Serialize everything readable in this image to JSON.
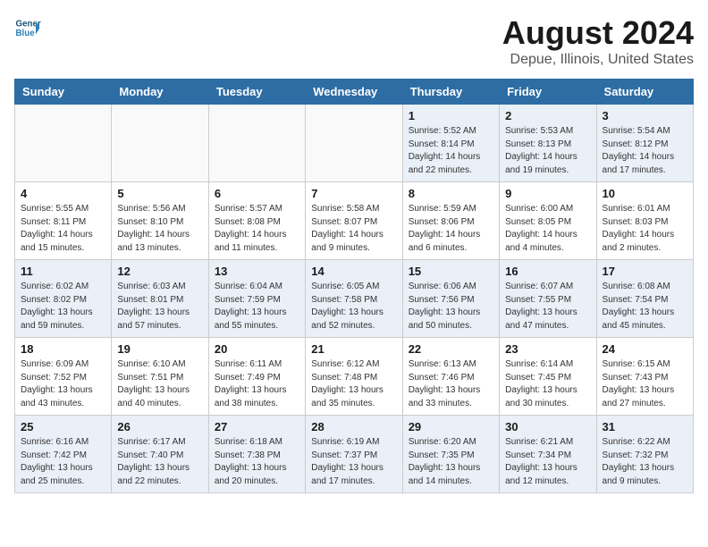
{
  "header": {
    "logo_line1": "General",
    "logo_line2": "Blue",
    "title": "August 2024",
    "subtitle": "Depue, Illinois, United States"
  },
  "weekdays": [
    "Sunday",
    "Monday",
    "Tuesday",
    "Wednesday",
    "Thursday",
    "Friday",
    "Saturday"
  ],
  "weeks": [
    [
      {
        "day": "",
        "info": "",
        "empty": true
      },
      {
        "day": "",
        "info": "",
        "empty": true
      },
      {
        "day": "",
        "info": "",
        "empty": true
      },
      {
        "day": "",
        "info": "",
        "empty": true
      },
      {
        "day": "1",
        "info": "Sunrise: 5:52 AM\nSunset: 8:14 PM\nDaylight: 14 hours\nand 22 minutes."
      },
      {
        "day": "2",
        "info": "Sunrise: 5:53 AM\nSunset: 8:13 PM\nDaylight: 14 hours\nand 19 minutes."
      },
      {
        "day": "3",
        "info": "Sunrise: 5:54 AM\nSunset: 8:12 PM\nDaylight: 14 hours\nand 17 minutes."
      }
    ],
    [
      {
        "day": "4",
        "info": "Sunrise: 5:55 AM\nSunset: 8:11 PM\nDaylight: 14 hours\nand 15 minutes."
      },
      {
        "day": "5",
        "info": "Sunrise: 5:56 AM\nSunset: 8:10 PM\nDaylight: 14 hours\nand 13 minutes."
      },
      {
        "day": "6",
        "info": "Sunrise: 5:57 AM\nSunset: 8:08 PM\nDaylight: 14 hours\nand 11 minutes."
      },
      {
        "day": "7",
        "info": "Sunrise: 5:58 AM\nSunset: 8:07 PM\nDaylight: 14 hours\nand 9 minutes."
      },
      {
        "day": "8",
        "info": "Sunrise: 5:59 AM\nSunset: 8:06 PM\nDaylight: 14 hours\nand 6 minutes."
      },
      {
        "day": "9",
        "info": "Sunrise: 6:00 AM\nSunset: 8:05 PM\nDaylight: 14 hours\nand 4 minutes."
      },
      {
        "day": "10",
        "info": "Sunrise: 6:01 AM\nSunset: 8:03 PM\nDaylight: 14 hours\nand 2 minutes."
      }
    ],
    [
      {
        "day": "11",
        "info": "Sunrise: 6:02 AM\nSunset: 8:02 PM\nDaylight: 13 hours\nand 59 minutes."
      },
      {
        "day": "12",
        "info": "Sunrise: 6:03 AM\nSunset: 8:01 PM\nDaylight: 13 hours\nand 57 minutes."
      },
      {
        "day": "13",
        "info": "Sunrise: 6:04 AM\nSunset: 7:59 PM\nDaylight: 13 hours\nand 55 minutes."
      },
      {
        "day": "14",
        "info": "Sunrise: 6:05 AM\nSunset: 7:58 PM\nDaylight: 13 hours\nand 52 minutes."
      },
      {
        "day": "15",
        "info": "Sunrise: 6:06 AM\nSunset: 7:56 PM\nDaylight: 13 hours\nand 50 minutes."
      },
      {
        "day": "16",
        "info": "Sunrise: 6:07 AM\nSunset: 7:55 PM\nDaylight: 13 hours\nand 47 minutes."
      },
      {
        "day": "17",
        "info": "Sunrise: 6:08 AM\nSunset: 7:54 PM\nDaylight: 13 hours\nand 45 minutes."
      }
    ],
    [
      {
        "day": "18",
        "info": "Sunrise: 6:09 AM\nSunset: 7:52 PM\nDaylight: 13 hours\nand 43 minutes."
      },
      {
        "day": "19",
        "info": "Sunrise: 6:10 AM\nSunset: 7:51 PM\nDaylight: 13 hours\nand 40 minutes."
      },
      {
        "day": "20",
        "info": "Sunrise: 6:11 AM\nSunset: 7:49 PM\nDaylight: 13 hours\nand 38 minutes."
      },
      {
        "day": "21",
        "info": "Sunrise: 6:12 AM\nSunset: 7:48 PM\nDaylight: 13 hours\nand 35 minutes."
      },
      {
        "day": "22",
        "info": "Sunrise: 6:13 AM\nSunset: 7:46 PM\nDaylight: 13 hours\nand 33 minutes."
      },
      {
        "day": "23",
        "info": "Sunrise: 6:14 AM\nSunset: 7:45 PM\nDaylight: 13 hours\nand 30 minutes."
      },
      {
        "day": "24",
        "info": "Sunrise: 6:15 AM\nSunset: 7:43 PM\nDaylight: 13 hours\nand 27 minutes."
      }
    ],
    [
      {
        "day": "25",
        "info": "Sunrise: 6:16 AM\nSunset: 7:42 PM\nDaylight: 13 hours\nand 25 minutes."
      },
      {
        "day": "26",
        "info": "Sunrise: 6:17 AM\nSunset: 7:40 PM\nDaylight: 13 hours\nand 22 minutes."
      },
      {
        "day": "27",
        "info": "Sunrise: 6:18 AM\nSunset: 7:38 PM\nDaylight: 13 hours\nand 20 minutes."
      },
      {
        "day": "28",
        "info": "Sunrise: 6:19 AM\nSunset: 7:37 PM\nDaylight: 13 hours\nand 17 minutes."
      },
      {
        "day": "29",
        "info": "Sunrise: 6:20 AM\nSunset: 7:35 PM\nDaylight: 13 hours\nand 14 minutes."
      },
      {
        "day": "30",
        "info": "Sunrise: 6:21 AM\nSunset: 7:34 PM\nDaylight: 13 hours\nand 12 minutes."
      },
      {
        "day": "31",
        "info": "Sunrise: 6:22 AM\nSunset: 7:32 PM\nDaylight: 13 hours\nand 9 minutes."
      }
    ]
  ]
}
